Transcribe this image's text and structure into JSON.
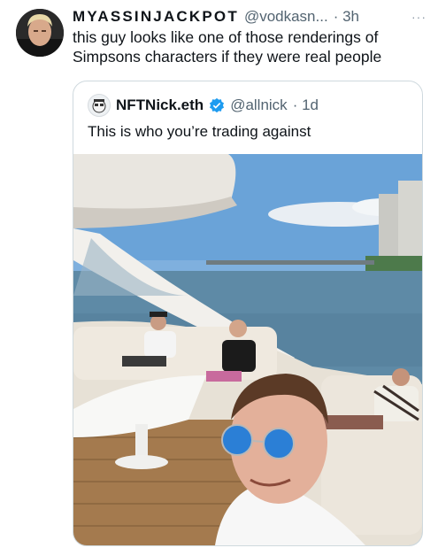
{
  "tweet": {
    "display_name": "MYASSINJACKPOT",
    "handle": "@vodkasn...",
    "time": "· 3h",
    "more_label": "···",
    "text": "this guy looks like one of those renderings of Simpsons characters if they were real people"
  },
  "quoted": {
    "display_name": "NFTNick.eth",
    "handle": "@allnick",
    "time": "· 1d",
    "text": "This is who you’re trading against"
  },
  "colors": {
    "text": "#0f1419",
    "secondary": "#536471",
    "border": "#cfd9de",
    "verified": "#1d9bf0"
  },
  "icons": {
    "more": "more-horizontal-icon",
    "verified": "verified-badge-icon"
  }
}
